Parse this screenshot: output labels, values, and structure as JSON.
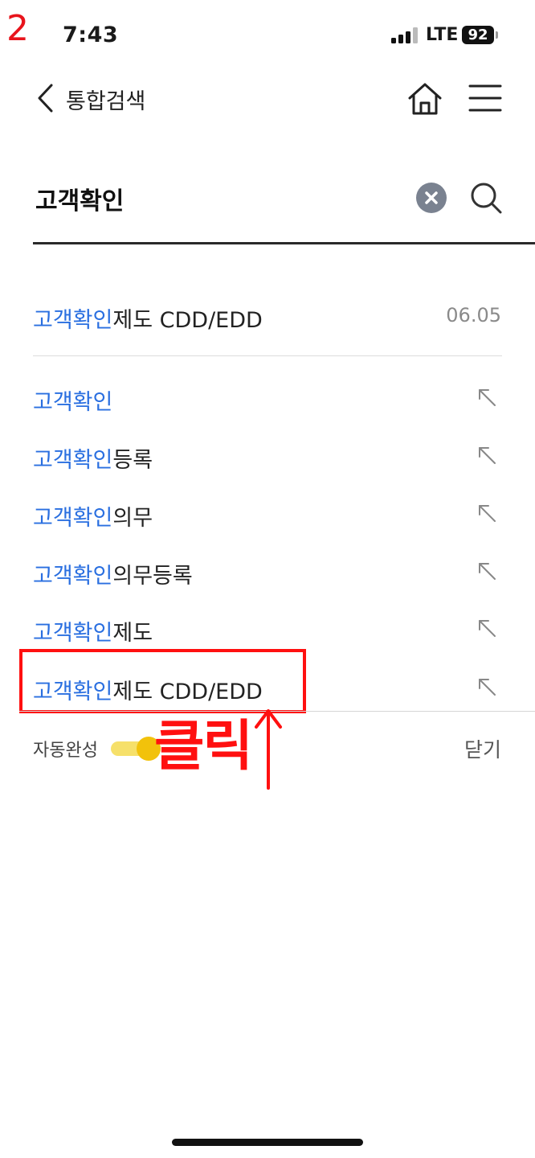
{
  "annotation": {
    "step_number": "2",
    "click_label": "클릭",
    "arrow_glyph": "↑"
  },
  "status_bar": {
    "time": "7:43",
    "network": "LTE",
    "battery": "92"
  },
  "header": {
    "title": "통합검색",
    "back_icon": "chevron-left-icon",
    "home_icon": "home-icon",
    "menu_icon": "hamburger-icon"
  },
  "search": {
    "query": "고객확인"
  },
  "recent": {
    "highlight": "고객확인",
    "rest": "제도 CDD/EDD",
    "date": "06.05"
  },
  "suggestions": [
    {
      "highlight": "고객확인",
      "rest": ""
    },
    {
      "highlight": "고객확인",
      "rest": "등록"
    },
    {
      "highlight": "고객확인",
      "rest": "의무"
    },
    {
      "highlight": "고객확인",
      "rest": "의무등록"
    },
    {
      "highlight": "고객확인",
      "rest": "제도"
    },
    {
      "highlight": "고객확인",
      "rest": "제도 CDD/EDD"
    }
  ],
  "footer": {
    "autocomplete_label": "자동완성",
    "autocomplete_on": true,
    "close_label": "닫기"
  },
  "colors": {
    "highlight": "#2a6fe0",
    "annotation_red": "#ff1010",
    "toggle": "#f2c20b"
  }
}
